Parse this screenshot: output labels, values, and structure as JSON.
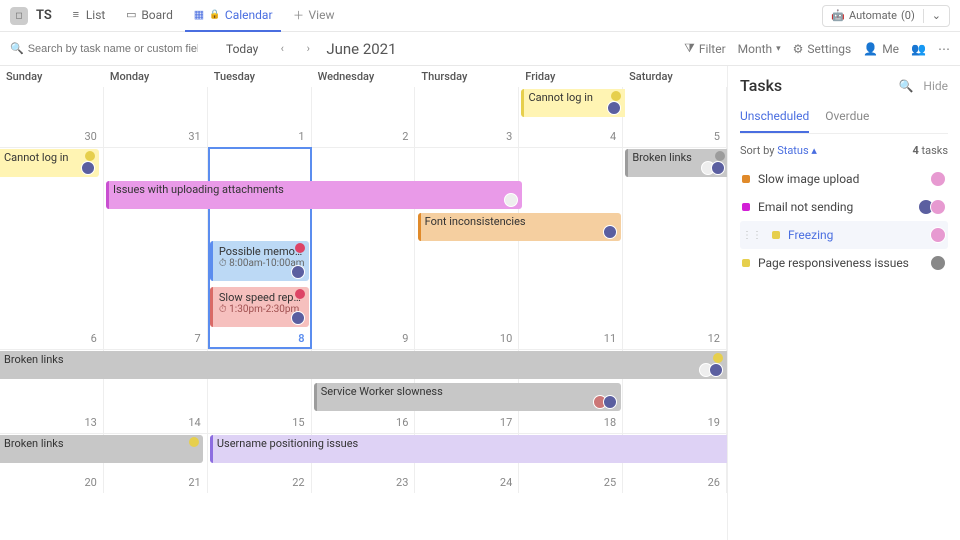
{
  "topbar": {
    "workspace": "TS",
    "views": {
      "list": "List",
      "board": "Board",
      "calendar": "Calendar",
      "add": "View"
    },
    "automate": {
      "label": "Automate",
      "count": "(0)"
    }
  },
  "secondbar": {
    "search_placeholder": "Search by task name or custom field…",
    "today": "Today",
    "month_title": "June 2021",
    "filter": "Filter",
    "month_select": "Month",
    "settings": "Settings",
    "me": "Me"
  },
  "calendar": {
    "dow": [
      "Sunday",
      "Monday",
      "Tuesday",
      "Wednesday",
      "Thursday",
      "Friday",
      "Saturday"
    ],
    "weeks": [
      {
        "days": [
          "30",
          "31",
          "1",
          "2",
          "3",
          "4",
          "5"
        ],
        "today_index": -1
      },
      {
        "days": [
          "6",
          "7",
          "8",
          "9",
          "10",
          "11",
          "12"
        ],
        "today_index": 2
      },
      {
        "days": [
          "13",
          "14",
          "15",
          "16",
          "17",
          "18",
          "19"
        ],
        "today_index": -1
      },
      {
        "days": [
          "20",
          "21",
          "22",
          "23",
          "24",
          "25",
          "26"
        ],
        "today_index": -1
      }
    ],
    "events": [
      {
        "week": 0,
        "lane": 0,
        "start": 5,
        "span": 1,
        "title": "Cannot log in",
        "bg": "#fff4b3",
        "border": "#e6cf4d",
        "open_start": false,
        "open_end": true,
        "badge": "#e6cf4d",
        "avatars": [
          "#5b5fa0"
        ]
      },
      {
        "week": 1,
        "lane": 0,
        "start": 0,
        "span": 1,
        "title": "Cannot log in",
        "bg": "#fff4b3",
        "border": "#e6cf4d",
        "open_start": true,
        "open_end": false,
        "badge": "#e6cf4d",
        "avatars": [
          "#5b5fa0"
        ]
      },
      {
        "week": 1,
        "lane": 0,
        "start": 6,
        "span": 1,
        "title": "Broken links",
        "bg": "#c7c7c7",
        "border": "#9c9c9c",
        "open_start": false,
        "open_end": true,
        "badge": "#9c9c9c",
        "avatars": [
          "#eee",
          "#5b5fa0"
        ]
      },
      {
        "week": 1,
        "lane": 1,
        "start": 1,
        "span": 4.05,
        "title": "Issues with uploading attachments",
        "bg": "#e99ae8",
        "border": "#c94fd1",
        "badge": null,
        "avatars": [
          "#eee"
        ]
      },
      {
        "week": 1,
        "lane": 2,
        "start": 2,
        "span": 1,
        "title": "Possible memory leak",
        "time": "8:00am-10:00am",
        "bg": "#bcd9f5",
        "border": "#5b8def",
        "timed": true,
        "badge": "#d46",
        "avatars": [
          "#5b5fa0"
        ]
      },
      {
        "week": 1,
        "lane": 2,
        "start": 4,
        "span": 2,
        "title": "Font inconsistencies",
        "bg": "#f5cfa0",
        "border": "#e08a2a",
        "badge": null,
        "avatars": [
          "#5b5fa0"
        ]
      },
      {
        "week": 1,
        "lane": 3,
        "start": 2,
        "span": 1,
        "title": "Slow speed reported",
        "time": "1:30pm-2:30pm",
        "bg": "#f6c0be",
        "border": "#d96a66",
        "timed": true,
        "badge": "#d46",
        "avatars": [
          "#5b5fa0"
        ]
      },
      {
        "week": 2,
        "lane": 0,
        "start": 0,
        "span": 7,
        "title": "Broken links",
        "bg": "#c7c7c7",
        "border": "#9c9c9c",
        "open_start": true,
        "open_end": true,
        "badge": "#e6cf4d",
        "avatars": [
          "#eee",
          "#5b5fa0"
        ]
      },
      {
        "week": 2,
        "lane": 1,
        "start": 3,
        "span": 3,
        "title": "Service Worker slowness",
        "bg": "#c7c7c7",
        "border": "#9c9c9c",
        "badge": null,
        "avatars": [
          "#c77",
          "#5b5fa0"
        ]
      },
      {
        "week": 3,
        "lane": 0,
        "start": 0,
        "span": 2,
        "title": "Broken links",
        "bg": "#c7c7c7",
        "border": "#9c9c9c",
        "open_start": true,
        "open_end": false,
        "badge": "#e6cf4d",
        "avatars": []
      },
      {
        "week": 3,
        "lane": 0,
        "start": 2,
        "span": 5,
        "title": "Username positioning issues",
        "bg": "#ded2f5",
        "border": "#8d6de0",
        "open_end": true,
        "badge": null,
        "avatars": []
      }
    ]
  },
  "sidebar": {
    "title": "Tasks",
    "hide": "Hide",
    "tabs": {
      "unscheduled": "Unscheduled",
      "overdue": "Overdue"
    },
    "sort": {
      "label": "Sort by",
      "value": "Status",
      "count": "4",
      "count_suffix": "tasks"
    },
    "tasks": [
      {
        "title": "Slow image upload",
        "color": "#e08a2a",
        "avatars": [
          "#e79ad1"
        ]
      },
      {
        "title": "Email not sending",
        "color": "#d21fd6",
        "avatars": [
          "#5b5fa0",
          "#e79ad1"
        ]
      },
      {
        "title": "Freezing",
        "color": "#e6cf4d",
        "avatars": [
          "#e79ad1"
        ],
        "hover": true
      },
      {
        "title": "Page responsiveness issues",
        "color": "#e6cf4d",
        "avatars": [
          "#888"
        ]
      }
    ]
  }
}
